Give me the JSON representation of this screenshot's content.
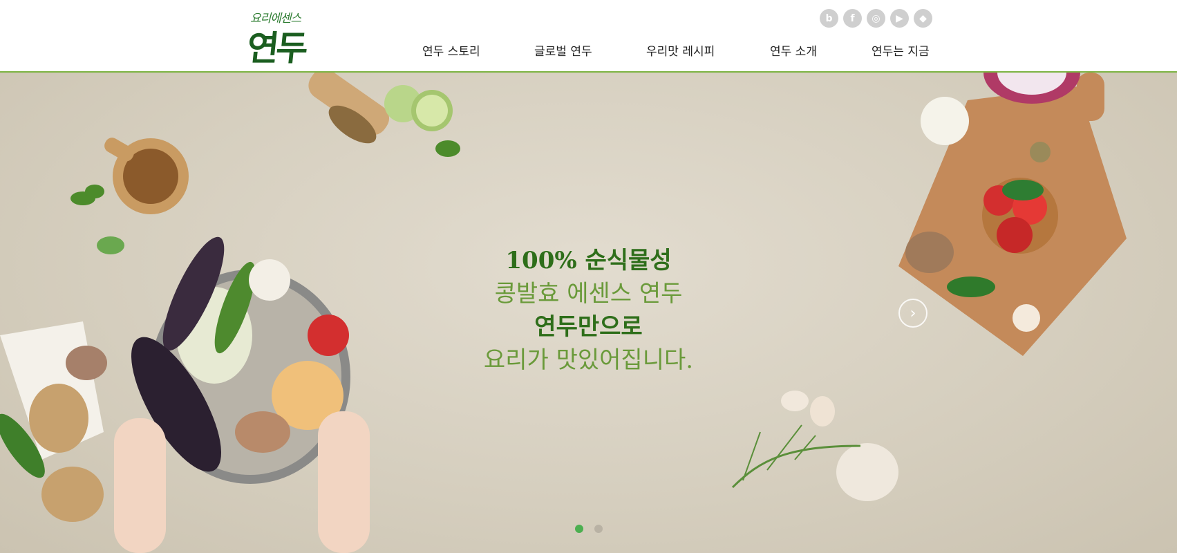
{
  "header": {
    "logo_small": "요리에센스",
    "logo_big": "연두",
    "social": [
      {
        "icon": "blog-icon",
        "glyph": "b"
      },
      {
        "icon": "facebook-icon",
        "glyph": "f"
      },
      {
        "icon": "instagram-icon",
        "glyph": "◎"
      },
      {
        "icon": "youtube-icon",
        "glyph": "▶"
      },
      {
        "icon": "shield-icon",
        "glyph": "◆"
      }
    ],
    "nav": [
      "연두 스토리",
      "글로벌 연두",
      "우리맛 레시피",
      "연두 소개",
      "연두는 지금"
    ]
  },
  "hero": {
    "line1": "100% 순식물성",
    "line2": "콩발효 에센스 연두",
    "line3": "연두만으로",
    "line4": "요리가 맛있어집니다.",
    "next_glyph": "›",
    "slides_total": 2,
    "slide_active": 1
  },
  "colors": {
    "accent": "#7cb342",
    "brand": "#1b5e20",
    "dot_active": "#4caf50"
  }
}
